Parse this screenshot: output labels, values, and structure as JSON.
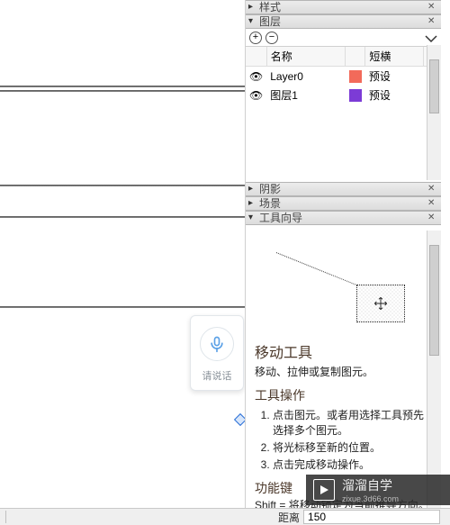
{
  "panels": {
    "style": {
      "title": "样式"
    },
    "layers": {
      "title": "图层",
      "headers": {
        "name": "名称",
        "dashes": "短横"
      },
      "rows": [
        {
          "name": "Layer0",
          "color": "#f26a5a",
          "dash": "预设",
          "editing": true
        },
        {
          "name": "图层1",
          "color": "#7c3bd6",
          "dash": "预设",
          "editing": false
        }
      ]
    },
    "shadows": {
      "title": "阴影"
    },
    "scenes": {
      "title": "场景"
    },
    "guide": {
      "title": "工具向导",
      "tool_title": "移动工具",
      "tool_sub": "移动、拉伸或复制图元。",
      "ops_title": "工具操作",
      "steps": [
        "点击图元。或者用选择工具预先选择多个图元。",
        "将光标移至新的位置。",
        "点击完成移动操作。"
      ],
      "func_title": "功能键",
      "func_line": "Shift = 将移动锁定为当前推导方向。"
    }
  },
  "voice": {
    "label": "请说话"
  },
  "status": {
    "label": "距离",
    "value": "150"
  },
  "watermark": {
    "brand": "溜溜自学",
    "url": "zixue.3d66.com"
  }
}
